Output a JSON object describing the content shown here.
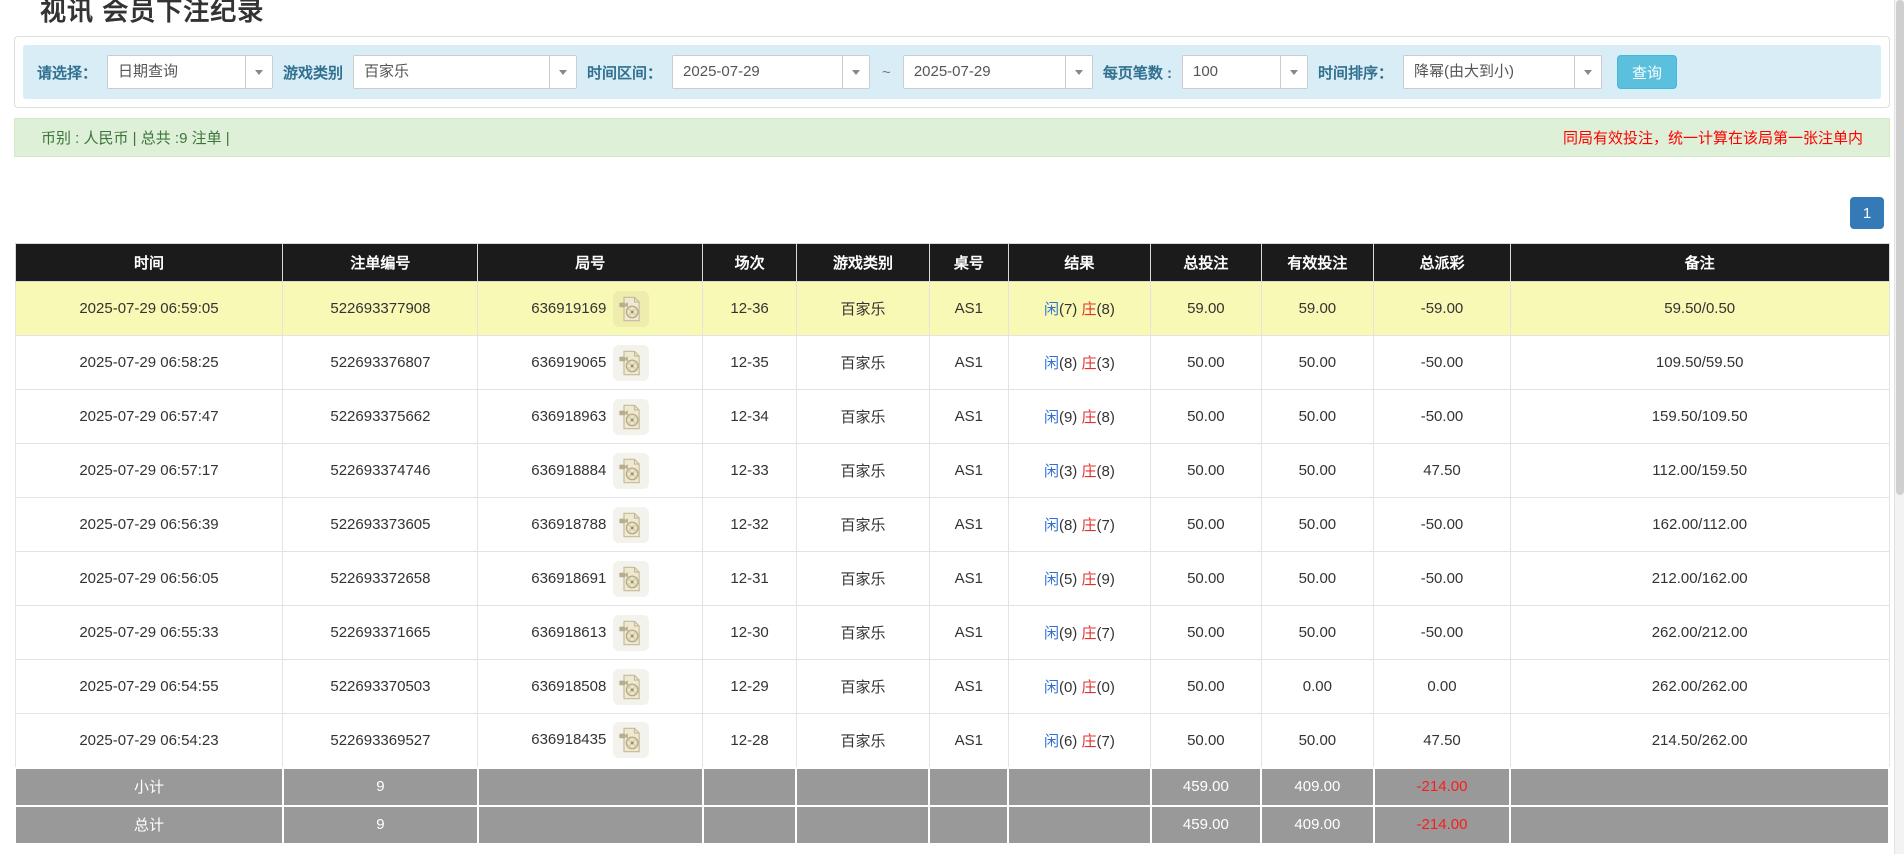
{
  "page": {
    "title": "视讯 会员下注纪录"
  },
  "filters": {
    "select_label": "请选择：",
    "select_value": "日期查询",
    "game_type_label": "游戏类别",
    "game_type_value": "百家乐",
    "time_range_label": "时间区间：",
    "date_from": "2025-07-29",
    "range_separator": "~",
    "date_to": "2025-07-29",
    "page_size_label": "每页笔数 :",
    "page_size_value": "100",
    "sort_label": "时间排序：",
    "sort_value": "降幂(由大到小)",
    "search_button": "查询"
  },
  "summary": {
    "left": "币别 : 人民币 | 总共 :9 注单 |",
    "right_notice": "同局有效投注，统一计算在该局第一张注单内"
  },
  "pagination": {
    "current": "1"
  },
  "table": {
    "headers": [
      "时间",
      "注单编号",
      "局号",
      "场次",
      "游戏类别",
      "桌号",
      "结果",
      "总投注",
      "有效投注",
      "总派彩",
      "备注"
    ],
    "rows": [
      {
        "time": "2025-07-29 06:59:05",
        "bet_id": "522693377908",
        "round_id": "636919169",
        "session": "12-36",
        "game": "百家乐",
        "table_no": "AS1",
        "player": "闲",
        "player_pts": "(7)",
        "banker": "庄",
        "banker_pts": "(8)",
        "total_bet": "59.00",
        "valid_bet": "59.00",
        "payout": "-59.00",
        "note": "59.50/0.50",
        "highlighted": true
      },
      {
        "time": "2025-07-29 06:58:25",
        "bet_id": "522693376807",
        "round_id": "636919065",
        "session": "12-35",
        "game": "百家乐",
        "table_no": "AS1",
        "player": "闲",
        "player_pts": "(8)",
        "banker": "庄",
        "banker_pts": "(3)",
        "total_bet": "50.00",
        "valid_bet": "50.00",
        "payout": "-50.00",
        "note": "109.50/59.50",
        "highlighted": false
      },
      {
        "time": "2025-07-29 06:57:47",
        "bet_id": "522693375662",
        "round_id": "636918963",
        "session": "12-34",
        "game": "百家乐",
        "table_no": "AS1",
        "player": "闲",
        "player_pts": "(9)",
        "banker": "庄",
        "banker_pts": "(8)",
        "total_bet": "50.00",
        "valid_bet": "50.00",
        "payout": "-50.00",
        "note": "159.50/109.50",
        "highlighted": false
      },
      {
        "time": "2025-07-29 06:57:17",
        "bet_id": "522693374746",
        "round_id": "636918884",
        "session": "12-33",
        "game": "百家乐",
        "table_no": "AS1",
        "player": "闲",
        "player_pts": "(3)",
        "banker": "庄",
        "banker_pts": "(8)",
        "total_bet": "50.00",
        "valid_bet": "50.00",
        "payout": "47.50",
        "note": "112.00/159.50",
        "highlighted": false
      },
      {
        "time": "2025-07-29 06:56:39",
        "bet_id": "522693373605",
        "round_id": "636918788",
        "session": "12-32",
        "game": "百家乐",
        "table_no": "AS1",
        "player": "闲",
        "player_pts": "(8)",
        "banker": "庄",
        "banker_pts": "(7)",
        "total_bet": "50.00",
        "valid_bet": "50.00",
        "payout": "-50.00",
        "note": "162.00/112.00",
        "highlighted": false
      },
      {
        "time": "2025-07-29 06:56:05",
        "bet_id": "522693372658",
        "round_id": "636918691",
        "session": "12-31",
        "game": "百家乐",
        "table_no": "AS1",
        "player": "闲",
        "player_pts": "(5)",
        "banker": "庄",
        "banker_pts": "(9)",
        "total_bet": "50.00",
        "valid_bet": "50.00",
        "payout": "-50.00",
        "note": "212.00/162.00",
        "highlighted": false
      },
      {
        "time": "2025-07-29 06:55:33",
        "bet_id": "522693371665",
        "round_id": "636918613",
        "session": "12-30",
        "game": "百家乐",
        "table_no": "AS1",
        "player": "闲",
        "player_pts": "(9)",
        "banker": "庄",
        "banker_pts": "(7)",
        "total_bet": "50.00",
        "valid_bet": "50.00",
        "payout": "-50.00",
        "note": "262.00/212.00",
        "highlighted": false
      },
      {
        "time": "2025-07-29 06:54:55",
        "bet_id": "522693370503",
        "round_id": "636918508",
        "session": "12-29",
        "game": "百家乐",
        "table_no": "AS1",
        "player": "闲",
        "player_pts": "(0)",
        "banker": "庄",
        "banker_pts": "(0)",
        "total_bet": "50.00",
        "valid_bet": "0.00",
        "payout": "0.00",
        "note": "262.00/262.00",
        "highlighted": false
      },
      {
        "time": "2025-07-29 06:54:23",
        "bet_id": "522693369527",
        "round_id": "636918435",
        "session": "12-28",
        "game": "百家乐",
        "table_no": "AS1",
        "player": "闲",
        "player_pts": "(6)",
        "banker": "庄",
        "banker_pts": "(7)",
        "total_bet": "50.00",
        "valid_bet": "50.00",
        "payout": "47.50",
        "note": "214.50/262.00",
        "highlighted": false
      }
    ],
    "totals": [
      {
        "label": "小计",
        "count": "9",
        "total_bet": "459.00",
        "valid_bet": "409.00",
        "payout": "-214.00",
        "note": ""
      },
      {
        "label": "总计",
        "count": "9",
        "total_bet": "459.00",
        "valid_bet": "409.00",
        "payout": "-214.00",
        "note": ""
      }
    ]
  },
  "colors": {
    "accent_blue": "#337ab7",
    "link_blue": "#3070d6",
    "player_blue": "#3070d6",
    "banker_red": "#e03131",
    "negative_red": "#f00000",
    "highlight_yellow": "#f9f9b6",
    "header_black": "#1b1b1b",
    "totals_gray": "#999999",
    "filter_bar_bg": "#d9edf7",
    "summary_bar_bg": "#dff0d8",
    "search_button_cyan": "#5bc0de"
  }
}
